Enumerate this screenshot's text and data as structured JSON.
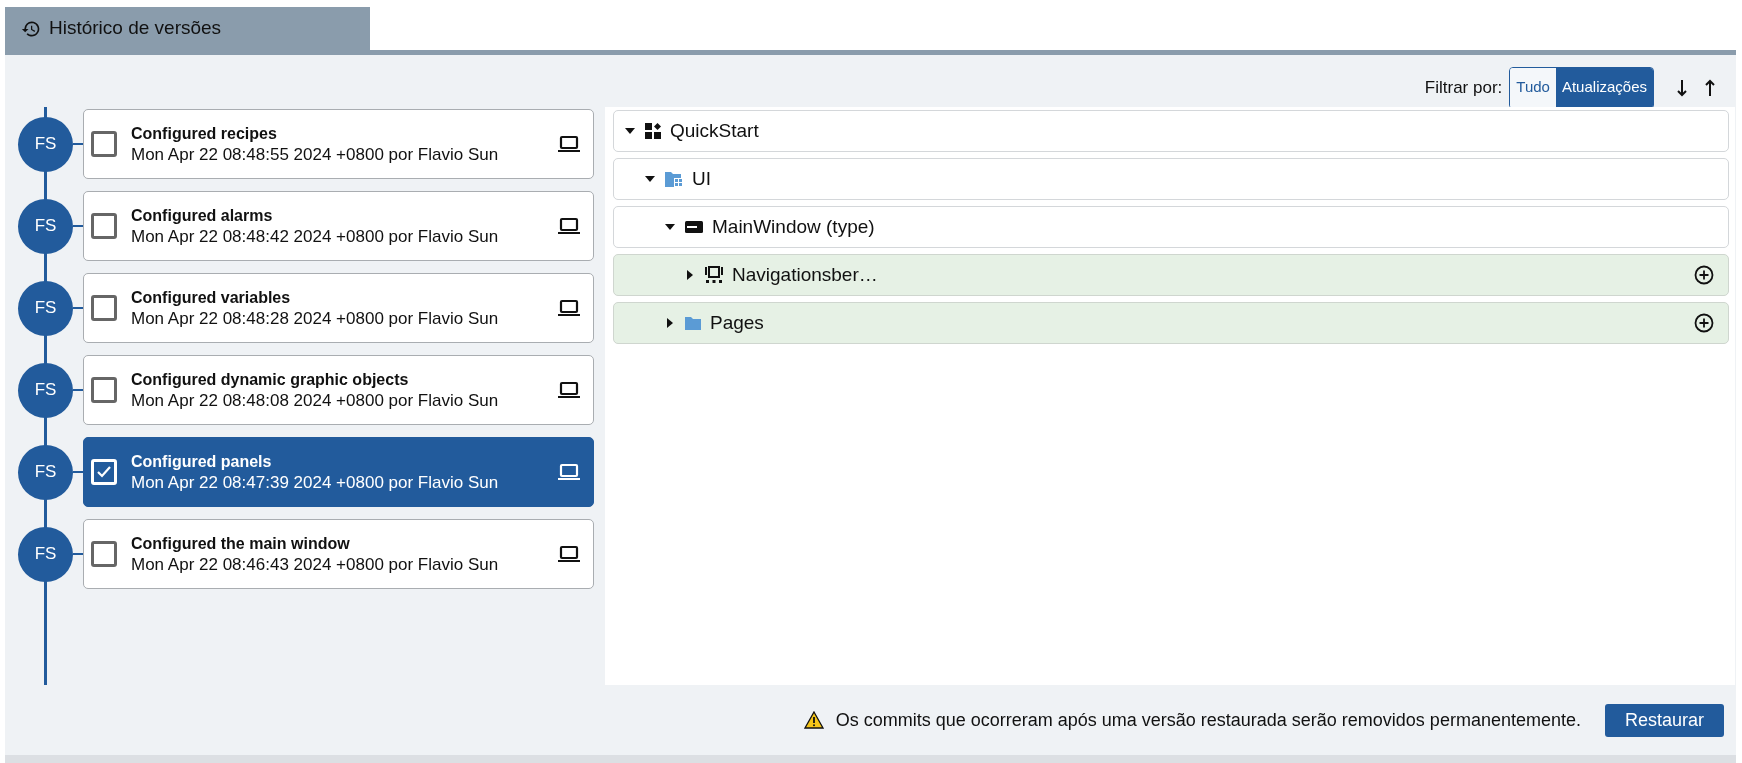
{
  "panel_tab": {
    "title": "Histórico de versões",
    "selected": true
  },
  "filter": {
    "label": "Filtrar por:",
    "options": [
      {
        "label": "Tudo",
        "selected": false
      },
      {
        "label": "Atualizações",
        "selected": true
      }
    ]
  },
  "commits": [
    {
      "avatar": "FS",
      "title": "Configured recipes",
      "meta": "Mon Apr 22 08:48:55 2024 +0800 por Flavio Sun",
      "checked": false,
      "selected": false
    },
    {
      "avatar": "FS",
      "title": "Configured alarms",
      "meta": "Mon Apr 22 08:48:42 2024 +0800 por Flavio Sun",
      "checked": false,
      "selected": false
    },
    {
      "avatar": "FS",
      "title": "Configured variables",
      "meta": "Mon Apr 22 08:48:28 2024 +0800 por Flavio Sun",
      "checked": false,
      "selected": false
    },
    {
      "avatar": "FS",
      "title": "Configured dynamic graphic objects",
      "meta": "Mon Apr 22 08:48:08 2024 +0800 por Flavio Sun",
      "checked": false,
      "selected": false
    },
    {
      "avatar": "FS",
      "title": "Configured panels",
      "meta": "Mon Apr 22 08:47:39 2024 +0800 por Flavio Sun",
      "checked": true,
      "selected": true
    },
    {
      "avatar": "FS",
      "title": "Configured the main window",
      "meta": "Mon Apr 22 08:46:43 2024 +0800 por Flavio Sun",
      "checked": false,
      "selected": false
    }
  ],
  "tree": [
    {
      "label": "QuickStart",
      "kind": "project",
      "expanded": true,
      "changed": false,
      "children": [
        {
          "label": "UI",
          "kind": "ui-folder",
          "expanded": true,
          "changed": false,
          "children": [
            {
              "label": "MainWindow (type)",
              "kind": "window",
              "expanded": true,
              "changed": false,
              "children": [
                {
                  "label": "Navigationsber…",
                  "kind": "widget",
                  "expanded": false,
                  "changed": true
                }
              ]
            },
            {
              "label": "Pages",
              "kind": "folder",
              "expanded": false,
              "changed": true
            }
          ]
        }
      ]
    }
  ],
  "footer": {
    "warning": "Os commits que ocorreram após uma versão restaurada serão removidos permanentemente.",
    "button": "Restaurar"
  }
}
